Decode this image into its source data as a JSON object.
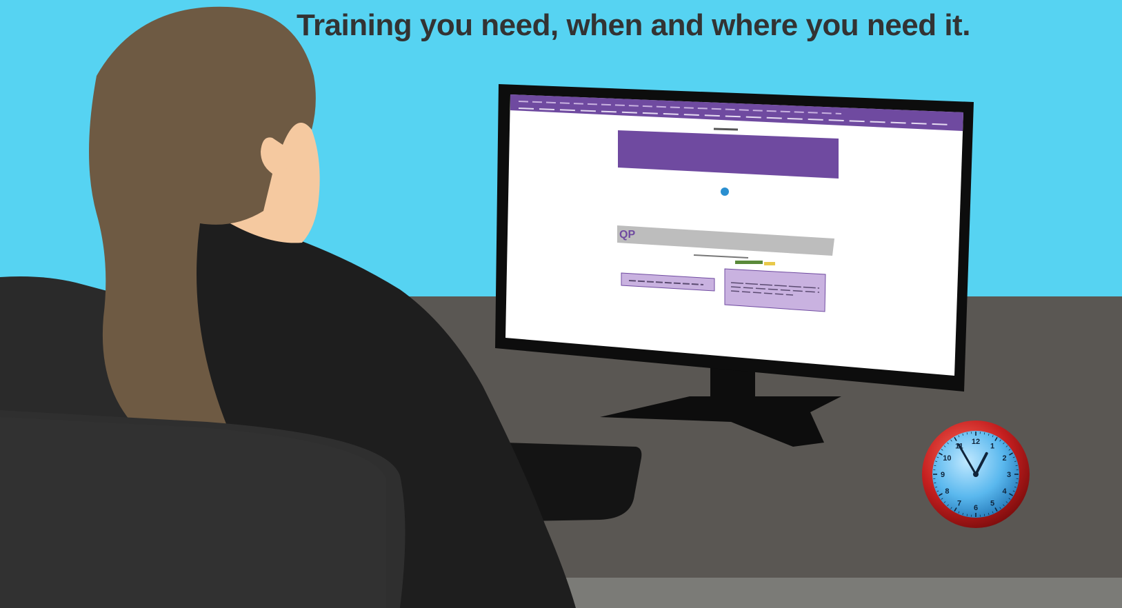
{
  "headline": "Training you need, when and where you need it.",
  "colors": {
    "sky": "#56d3f2",
    "desk": "#5a5753",
    "floor": "#7b7b77",
    "hair": "#6e5a43",
    "skin": "#f5c9a0",
    "jacket": "#1e1e1e",
    "chair": "#2f2f2f",
    "screen_purple": "#6f4aa0",
    "screen_lavender": "#c9b2e0",
    "clock_rim": "#c41f1f",
    "clock_face": "#2a8fd0"
  },
  "icons": [
    "clock-icon"
  ],
  "screen": {
    "logo_text": "QP"
  },
  "clock": {
    "numbers": [
      "12",
      "1",
      "2",
      "3",
      "4",
      "5",
      "6",
      "7",
      "8",
      "9",
      "10",
      "11"
    ],
    "hour": 12,
    "minute": 55
  }
}
